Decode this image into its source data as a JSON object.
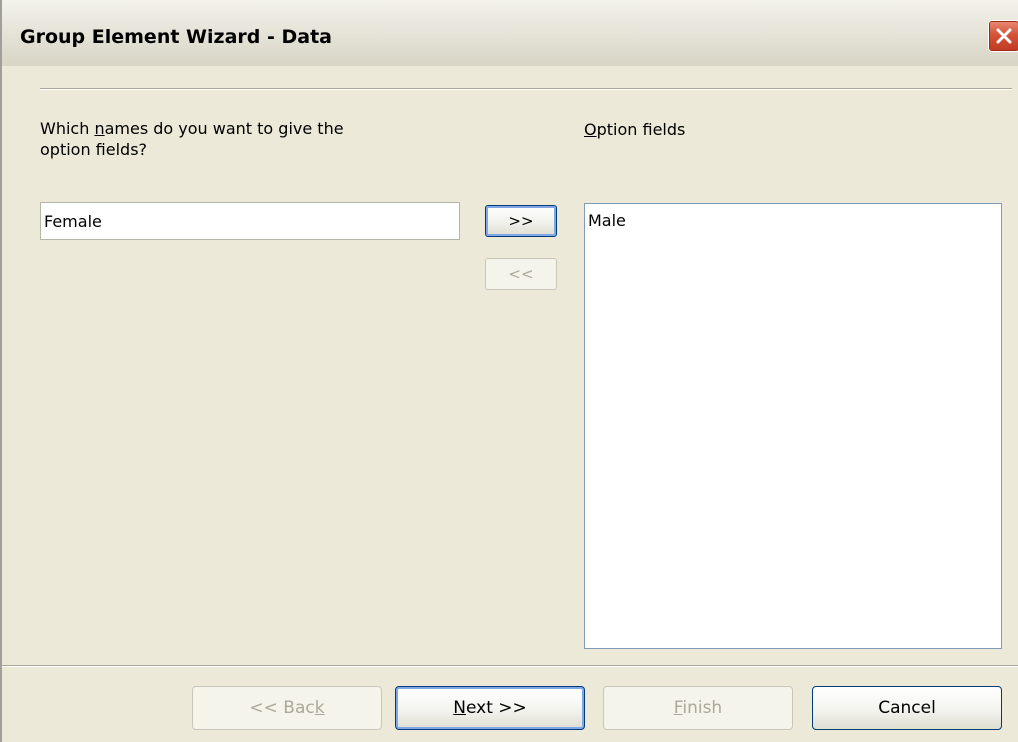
{
  "window": {
    "title": "Group Element Wizard - Data"
  },
  "question": {
    "line1_prefix": "Which ",
    "line1_accel": "n",
    "line1_suffix": "ames do you want to give the",
    "line2": "option fields?"
  },
  "name_input": {
    "value": "Female"
  },
  "transfer": {
    "add_label": ">>",
    "remove_label": "<<"
  },
  "options": {
    "label_accel": "O",
    "label_rest": "ption fields",
    "items": [
      "Male"
    ]
  },
  "footer": {
    "back_prefix": "<< Bac",
    "back_accel": "k",
    "next_accel": "N",
    "next_rest": "ext >>",
    "finish_accel": "F",
    "finish_rest": "inish",
    "cancel_label": "Cancel"
  },
  "icons": {
    "close": "close-icon"
  },
  "colors": {
    "dialog_bg": "#ece9d8",
    "close_button": "#d4533a",
    "list_border": "#7f9db9",
    "disabled_text": "#aca899"
  }
}
